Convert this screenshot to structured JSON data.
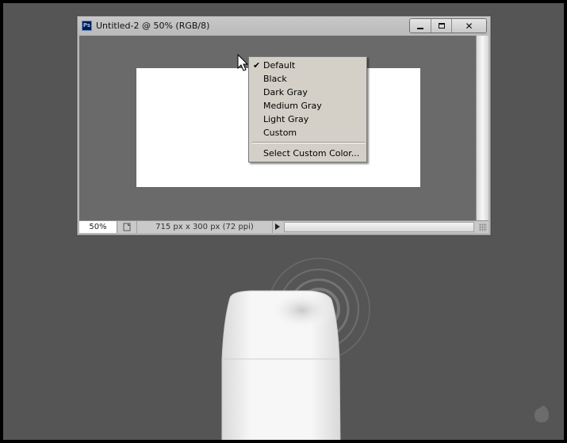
{
  "window": {
    "title": "Untitled-2 @ 50% (RGB/8)",
    "app_icon": "photoshop-icon",
    "app_icon_text": "Ps",
    "buttons": {
      "minimize": "minimize-icon",
      "maximize": "maximize-icon",
      "close_label": "✕"
    }
  },
  "status_bar": {
    "zoom": "50%",
    "doc_info": "715 px x 300 px (72 ppi)"
  },
  "context_menu": {
    "items": [
      {
        "label": "Default",
        "checked": true
      },
      {
        "label": "Black",
        "checked": false
      },
      {
        "label": "Dark Gray",
        "checked": false
      },
      {
        "label": "Medium Gray",
        "checked": false
      },
      {
        "label": "Light Gray",
        "checked": false
      },
      {
        "label": "Custom",
        "checked": false
      }
    ],
    "extra_item": "Select Custom Color...",
    "check_glyph": "✔"
  },
  "colors": {
    "stage_background": "#555555",
    "pasteboard": "#6a6a6a",
    "canvas": "#ffffff",
    "menu_background": "#d4d0c8"
  }
}
